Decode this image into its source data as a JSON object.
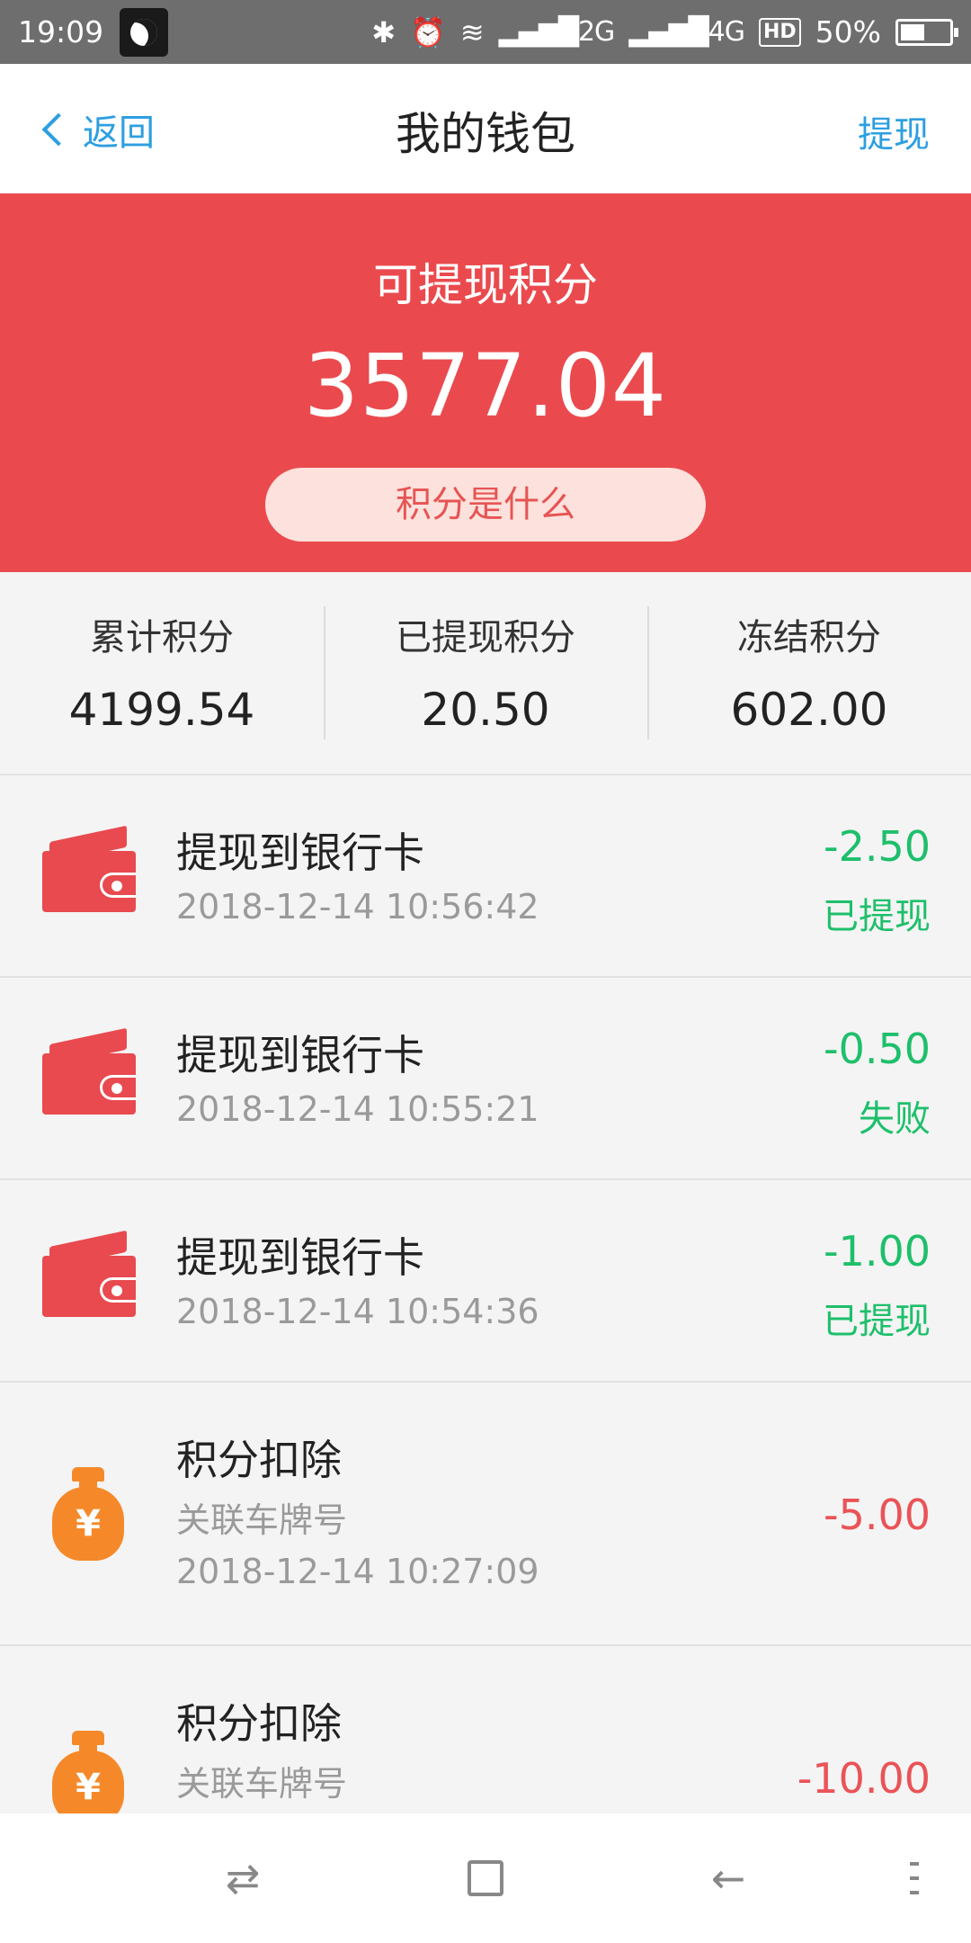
{
  "status_bar": {
    "time": "19:09",
    "network_2g": "2G",
    "network_4g": "4G",
    "hd": "HD",
    "battery": "50%"
  },
  "header": {
    "back_label": "返回",
    "title": "我的钱包",
    "action_label": "提现"
  },
  "banner": {
    "label": "可提现积分",
    "amount": "3577.04",
    "help_button": "积分是什么",
    "color": "#ea4a4e"
  },
  "stats": [
    {
      "label": "累计积分",
      "value": "4199.54"
    },
    {
      "label": "已提现积分",
      "value": "20.50"
    },
    {
      "label": "冻结积分",
      "value": "602.00"
    }
  ],
  "transactions": [
    {
      "icon": "wallet-icon",
      "title": "提现到银行卡",
      "time": "2018-12-14 10:56:42",
      "amount": "-2.50",
      "status": "已提现"
    },
    {
      "icon": "wallet-icon",
      "title": "提现到银行卡",
      "time": "2018-12-14 10:55:21",
      "amount": "-0.50",
      "status": "失败"
    },
    {
      "icon": "wallet-icon",
      "title": "提现到银行卡",
      "time": "2018-12-14 10:54:36",
      "amount": "-1.00",
      "status": "已提现"
    },
    {
      "icon": "money-bag-icon",
      "title": "积分扣除",
      "subtitle": "关联车牌号",
      "time": "2018-12-14 10:27:09",
      "amount": "-5.00"
    },
    {
      "icon": "money-bag-icon",
      "title": "积分扣除",
      "subtitle": "关联车牌号",
      "amount": "-10.00"
    }
  ],
  "colors": {
    "accent_blue": "#2d9fe0",
    "positive_green": "#1ebf6b",
    "negative_red": "#ea5357",
    "bag_orange": "#f5892a"
  },
  "icons": {
    "bag_glyph": "¥",
    "nav_recent": "⇄",
    "nav_back": "←"
  }
}
